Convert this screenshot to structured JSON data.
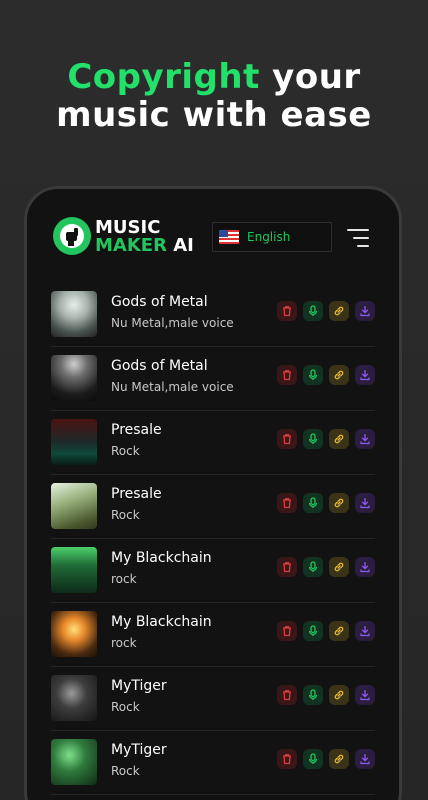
{
  "headline": {
    "accent": "Copyright",
    "line1_rest": " your",
    "line2": "music with ease"
  },
  "app": {
    "brand_line1": "MUSIC",
    "brand_line2": "MAKER",
    "brand_ai": "AI",
    "language": "English"
  },
  "colors": {
    "accent": "#22c55e",
    "delete": "#e23b3b",
    "mic": "#22c55e",
    "link": "#e8b630",
    "download": "#8b5cf6"
  },
  "tracks": [
    {
      "title": "Gods of Metal",
      "genre": "Nu Metal,male voice"
    },
    {
      "title": "Gods of Metal",
      "genre": "Nu Metal,male voice"
    },
    {
      "title": "Presale",
      "genre": "Rock"
    },
    {
      "title": "Presale",
      "genre": "Rock"
    },
    {
      "title": "My Blackchain",
      "genre": "rock"
    },
    {
      "title": "My Blackchain",
      "genre": "rock"
    },
    {
      "title": "MyTiger",
      "genre": "Rock"
    },
    {
      "title": "MyTiger",
      "genre": "Rock"
    }
  ]
}
